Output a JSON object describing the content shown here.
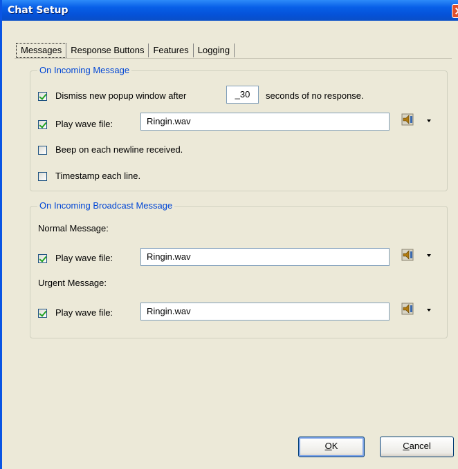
{
  "window": {
    "title": "Chat Setup"
  },
  "tabs": [
    {
      "label": "Messages",
      "active": true
    },
    {
      "label": "Response Buttons",
      "active": false
    },
    {
      "label": "Features",
      "active": false
    },
    {
      "label": "Logging",
      "active": false
    }
  ],
  "incoming": {
    "legend": "On Incoming Message",
    "dismiss": {
      "label_before": "Dismiss new popup window after",
      "value": "_30",
      "label_after": "seconds of no response.",
      "checked": true
    },
    "play_wave": {
      "label": "Play wave file:",
      "value": "Ringin.wav",
      "checked": true
    },
    "beep": {
      "label": "Beep on each newline received.",
      "checked": false
    },
    "timestamp": {
      "label": "Timestamp each line.",
      "checked": false
    }
  },
  "broadcast": {
    "legend": "On Incoming Broadcast Message",
    "normal": {
      "heading": "Normal Message:",
      "label": "Play wave file:",
      "value": "Ringin.wav",
      "checked": true
    },
    "urgent": {
      "heading": "Urgent Message:",
      "label": "Play wave file:",
      "value": "Ringin.wav",
      "checked": true
    }
  },
  "buttons": {
    "ok": {
      "accel": "O",
      "rest": "K"
    },
    "cancel": {
      "accel": "C",
      "rest": "ancel"
    }
  },
  "icons": {
    "speaker": "speaker-icon",
    "dropdown": "dropdown-arrow-icon",
    "close": "close-icon"
  },
  "colors": {
    "titlebar": "#0a55e4",
    "legend_text": "#0046d5",
    "check": "#21a121",
    "dialog_bg": "#ece9d8"
  }
}
